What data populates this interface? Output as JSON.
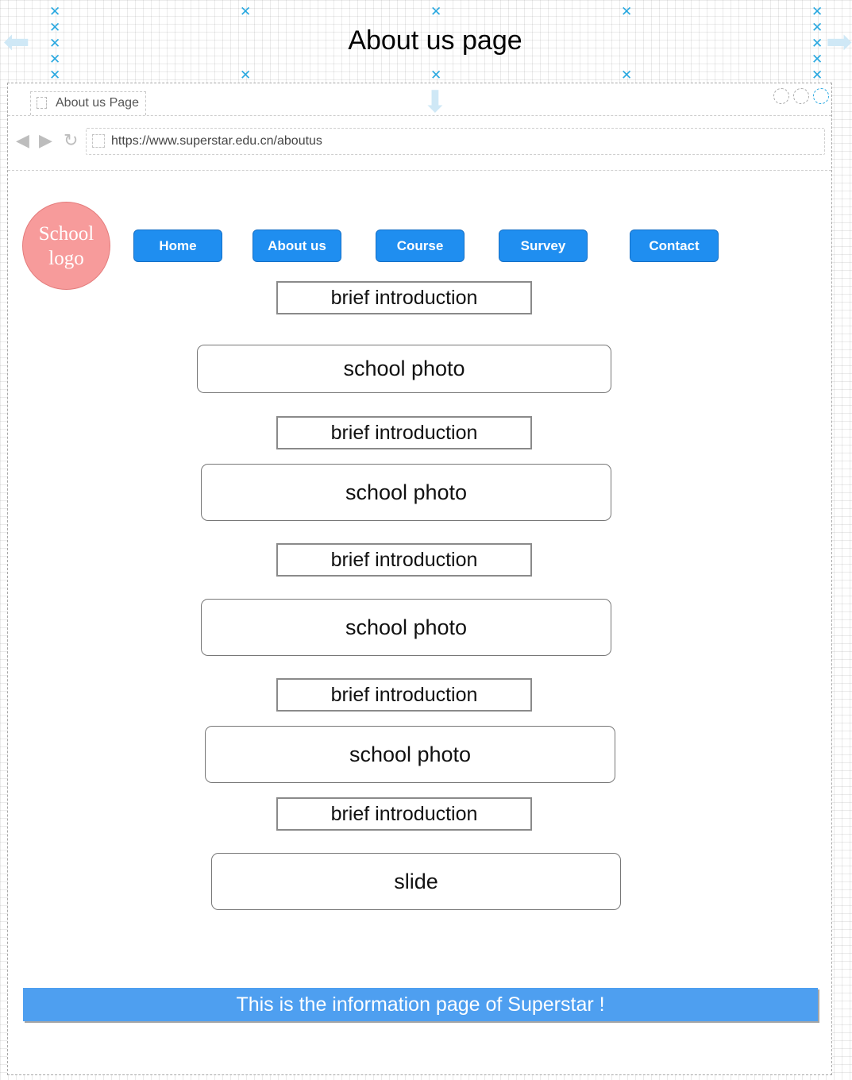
{
  "canvas": {
    "title": "About us page"
  },
  "browser": {
    "tab_title": "About us Page",
    "url": "https://www.superstar.edu.cn/aboutus"
  },
  "logo": {
    "line1": "School",
    "line2": "logo"
  },
  "nav": {
    "items": [
      {
        "label": "Home"
      },
      {
        "label": "About us"
      },
      {
        "label": "Course"
      },
      {
        "label": "Survey"
      },
      {
        "label": "Contact"
      }
    ]
  },
  "content": {
    "blocks": [
      {
        "kind": "intro",
        "label": "brief introduction"
      },
      {
        "kind": "photo",
        "label": "school photo"
      },
      {
        "kind": "intro",
        "label": "brief introduction"
      },
      {
        "kind": "photo",
        "label": "school photo"
      },
      {
        "kind": "intro",
        "label": "brief introduction"
      },
      {
        "kind": "photo",
        "label": "school photo"
      },
      {
        "kind": "intro",
        "label": "brief introduction"
      },
      {
        "kind": "photo",
        "label": "school photo"
      },
      {
        "kind": "intro",
        "label": "brief introduction"
      },
      {
        "kind": "slide",
        "label": "slide"
      }
    ]
  },
  "footer": {
    "text": "This is the information page of Superstar !"
  },
  "colors": {
    "nav_button": "#1f8ef0",
    "logo": "#f79b9b",
    "footer": "#4e9ff0",
    "marker": "#29a8e0"
  }
}
